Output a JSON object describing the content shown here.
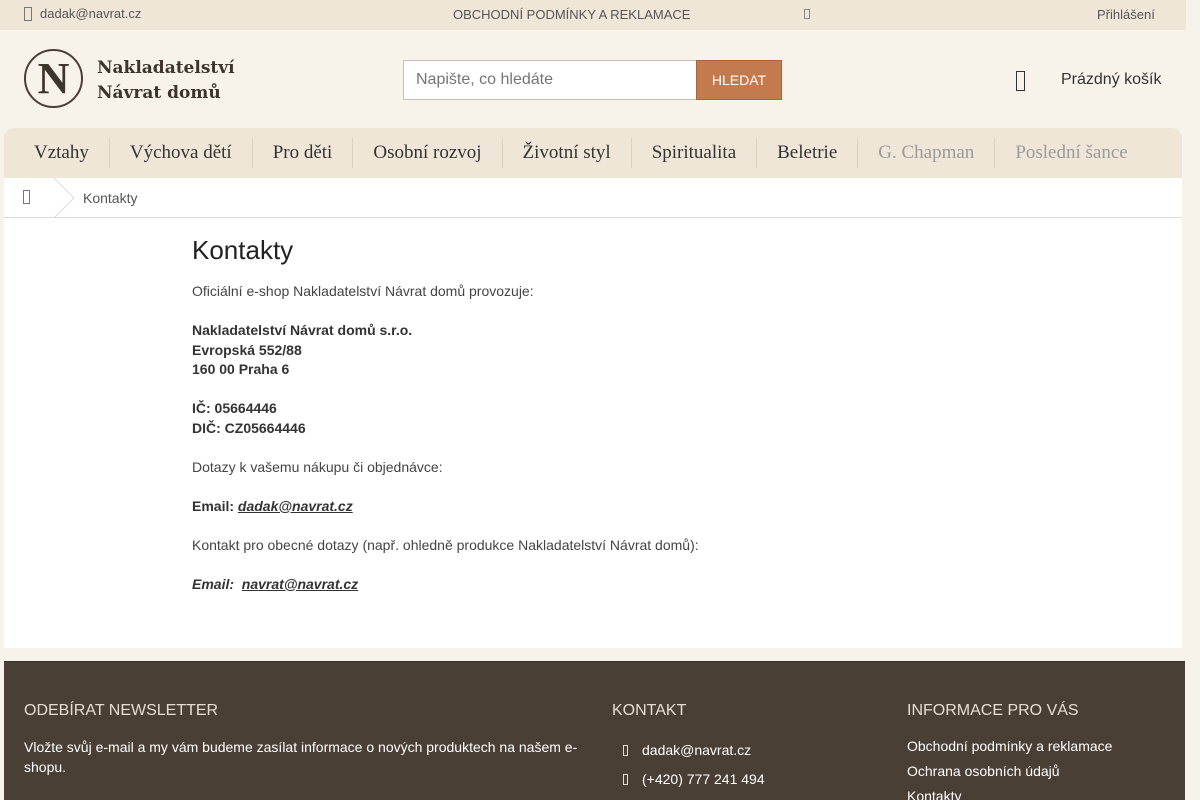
{
  "topbar": {
    "email": "dadak@navrat.cz",
    "terms": "OBCHODNÍ PODMÍNKY A REKLAMACE",
    "login": "Přihlášení"
  },
  "header": {
    "logo_letter": "N",
    "logo_line1": "Nakladatelství",
    "logo_line2": "Návrat domů",
    "search_placeholder": "Napište, co hledáte",
    "search_button": "HLEDAT",
    "cart_label": "Prázdný košík"
  },
  "nav": {
    "items": [
      {
        "label": "Vztahy"
      },
      {
        "label": "Výchova dětí"
      },
      {
        "label": "Pro děti"
      },
      {
        "label": "Osobní rozvoj"
      },
      {
        "label": "Životní styl"
      },
      {
        "label": "Spiritualita"
      },
      {
        "label": "Beletrie"
      },
      {
        "label": "G. Chapman"
      },
      {
        "label": "Poslední šance"
      }
    ]
  },
  "breadcrumb": {
    "current": "Kontakty"
  },
  "page": {
    "title": "Kontakty",
    "intro": "Oficiální e-shop Nakladatelství Návrat domů provozuje:",
    "company": "Nakladatelství Návrat domů s.r.o.",
    "street": "Evropská 552/88",
    "city": "160 00 Praha 6",
    "ic": "IČ: 05664446",
    "dic": "DIČ: CZ05664446",
    "orders_question": "Dotazy k vašemu nákupu či objednávce:",
    "email_label": "Email:",
    "orders_email": "dadak@navrat.cz",
    "general_question": "Kontakt pro obecné dotazy (např. ohledně produkce Nakladatelství Návrat domů):",
    "email_label2": "Email:",
    "general_email": "navrat@navrat.cz"
  },
  "footer": {
    "newsletter_title": "ODEBÍRAT NEWSLETTER",
    "newsletter_text": "Vložte svůj e-mail a my vám budeme zasílat informace o nových produktech na našem e-shopu.",
    "contact_title": "KONTAKT",
    "contact_email": "dadak@navrat.cz",
    "contact_phone": "(+420) 777 241 494",
    "info_title": "INFORMACE PRO VÁS",
    "info_links": [
      "Obchodní podmínky a reklamace",
      "Ochrana osobních údajů",
      "Kontakty"
    ]
  }
}
